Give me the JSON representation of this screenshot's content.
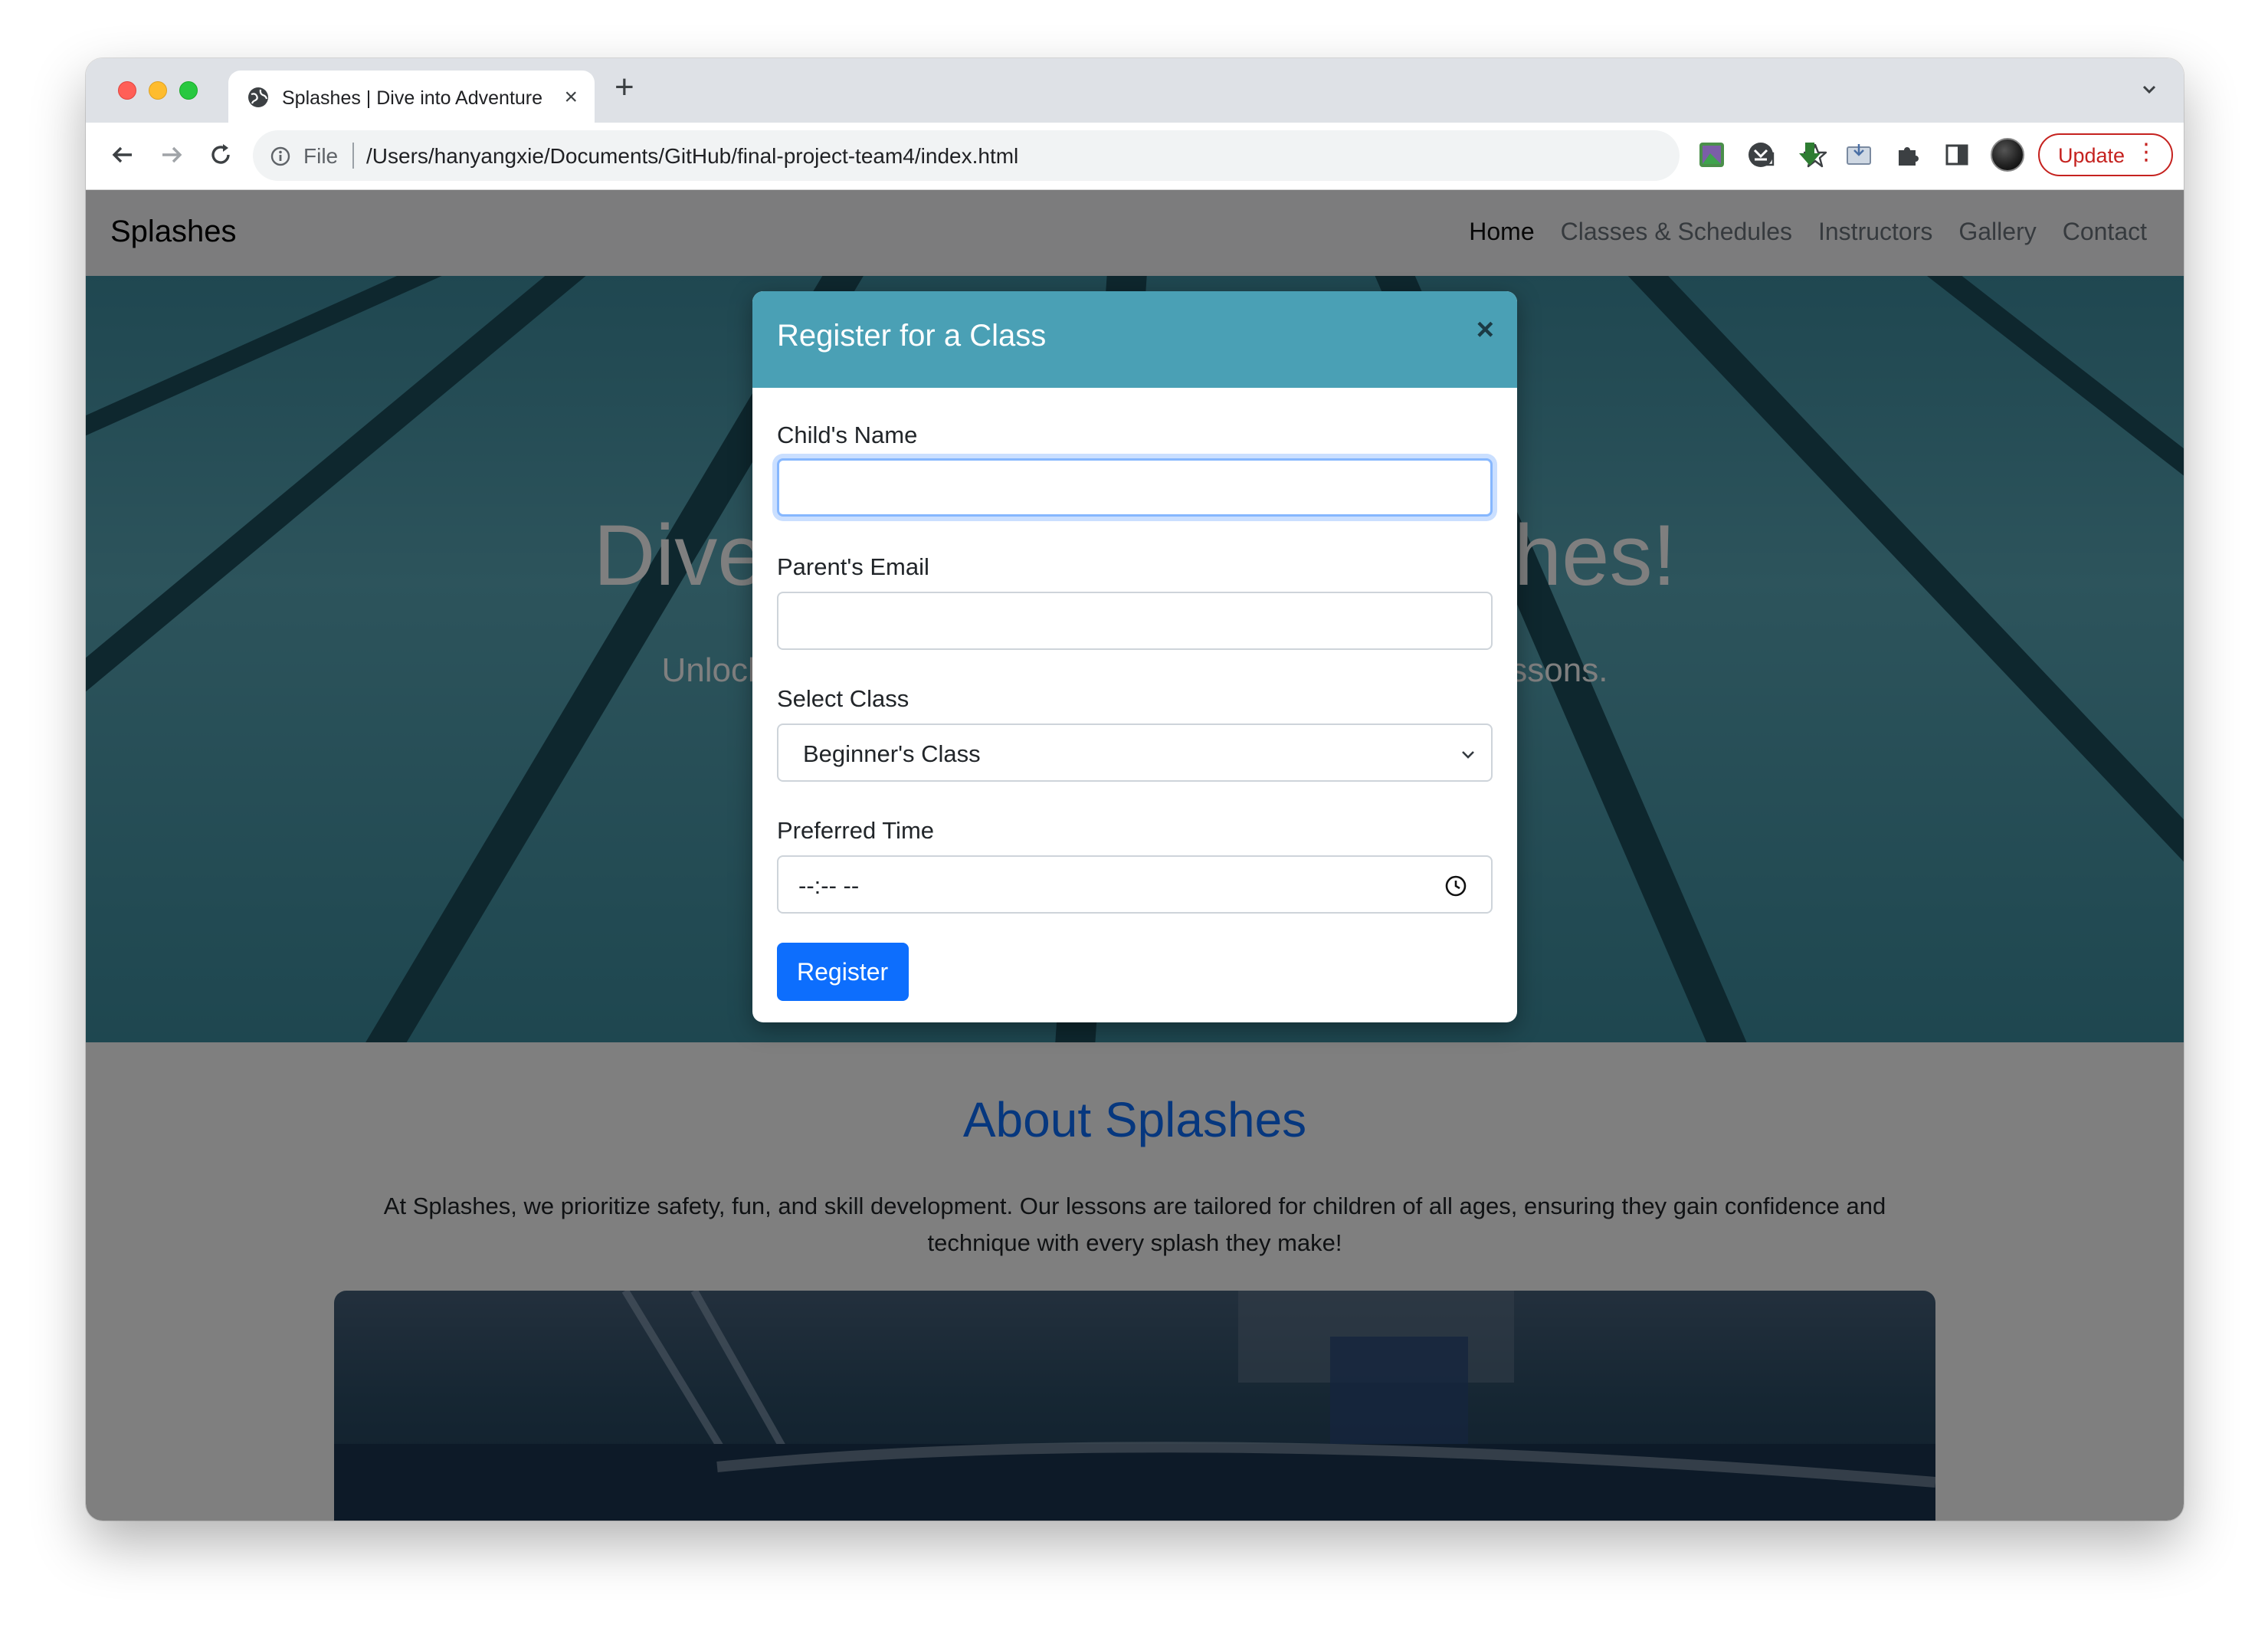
{
  "browser": {
    "tab_title": "Splashes | Dive into Adventure",
    "tab_close": "×",
    "new_tab": "+",
    "file_label": "File",
    "url": "/Users/hanyangxie/Documents/GitHub/final-project-team4/index.html",
    "update_label": "Update",
    "menu_dots": "⋮"
  },
  "site": {
    "brand": "Splashes",
    "nav": [
      {
        "label": "Home",
        "active": true
      },
      {
        "label": "Classes & Schedules",
        "active": false
      },
      {
        "label": "Instructors",
        "active": false
      },
      {
        "label": "Gallery",
        "active": false
      },
      {
        "label": "Contact",
        "active": false
      }
    ],
    "hero_title": "Dive into Fun with Splashes!",
    "hero_subtitle": "Unlock the world of swimming with our expertly crafted lessons.",
    "about_title": "About Splashes",
    "about_text": "At Splashes, we prioritize safety, fun, and skill development. Our lessons are tailored for children of all ages, ensuring they gain confidence and technique with every splash they make!"
  },
  "modal": {
    "title": "Register for a Class",
    "close": "×",
    "child_name_label": "Child's Name",
    "child_name_value": "",
    "parent_email_label": "Parent's Email",
    "parent_email_value": "",
    "select_class_label": "Select Class",
    "select_class_value": "Beginner's Class",
    "preferred_time_label": "Preferred Time",
    "preferred_time_value": "--:-- --",
    "register_label": "Register"
  },
  "colors": {
    "modal_header": "#4aa0b5",
    "primary": "#0d6efd",
    "update_red": "#c5221f"
  }
}
